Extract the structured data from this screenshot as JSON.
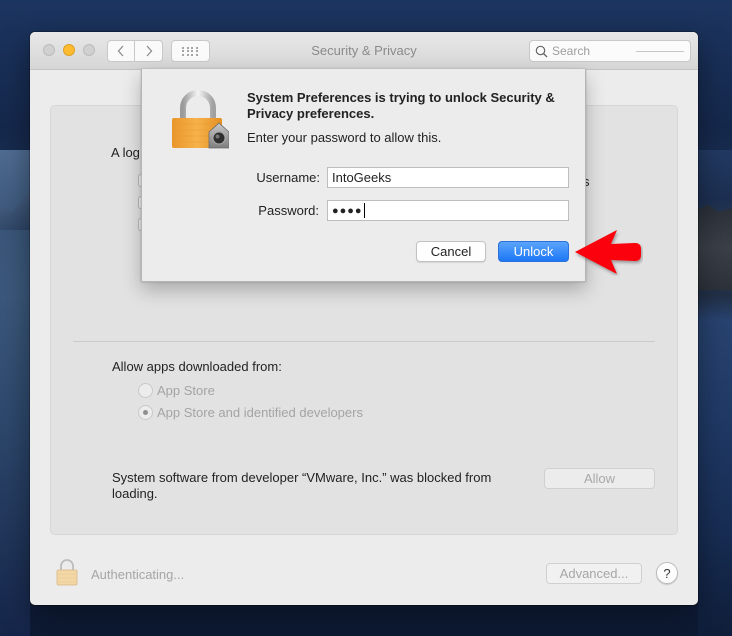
{
  "window": {
    "title": "Security & Privacy",
    "search_placeholder": "Search"
  },
  "background_content": {
    "partial_heading": "A log",
    "partial_right_text": "s",
    "allow_apps_label": "Allow apps downloaded from:",
    "radio_options": [
      {
        "label": "App Store",
        "selected": false
      },
      {
        "label": "App Store and identified developers",
        "selected": true
      }
    ],
    "blocked_message": "System software from developer “VMware, Inc.” was blocked from loading.",
    "allow_button": "Allow"
  },
  "footer": {
    "status": "Authenticating...",
    "advanced_button": "Advanced...",
    "help_button": "?"
  },
  "dialog": {
    "title": "System Preferences is trying to unlock Security & Privacy preferences.",
    "subtitle": "Enter your password to allow this.",
    "username_label": "Username:",
    "username_value": "IntoGeeks",
    "password_label": "Password:",
    "password_value": "●●●●",
    "cancel_button": "Cancel",
    "unlock_button": "Unlock"
  },
  "colors": {
    "accent": "#1d77f6",
    "annotation_arrow": "#ff0000",
    "lock_body": "#f0a830"
  }
}
